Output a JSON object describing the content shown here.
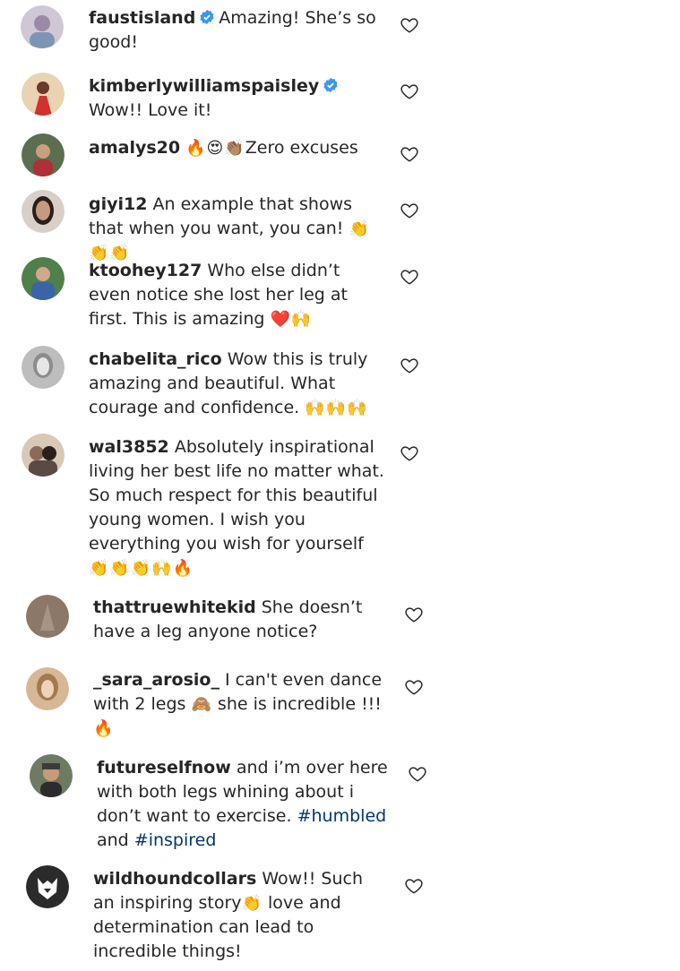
{
  "comments": [
    {
      "username": "faustisland",
      "verified": true,
      "text": "Amazing! She’s so good!",
      "avatar": "#b9a4b6"
    },
    {
      "username": "kimberlywilliamspaisley",
      "verified": true,
      "text": "Wow!! Love it!",
      "avatar": "#c98f6d"
    },
    {
      "username": "amalys20",
      "emoji": "🔥😍👏🏽",
      "text": "Zero excuses",
      "avatar": "#8a7a67"
    },
    {
      "username": "giyi12",
      "text": "An example that shows that when you want, you can!",
      "emoji": "👏👏👏",
      "avatar": "#4b3a31"
    },
    {
      "username": "ktoohey127",
      "text": "Who else didn’t even notice she lost her leg at first. This is amazing",
      "emoji": "❤️🙌",
      "avatar": "#5f7d90"
    },
    {
      "username": "chabelita_rico",
      "text": "Wow this is truly amazing and beautiful. What courage and confidence.",
      "emoji": "🙌🙌🙌",
      "avatar": "#a0a0a0"
    },
    {
      "username": "wal3852",
      "text": "Absolutely inspirational living her best life no matter what. So much respect for this beautiful young women. I wish you everything you wish for yourself",
      "emoji": "👏👏👏🙌🔥",
      "avatar": "#6a5a55"
    },
    {
      "username": "thattruewhitekid",
      "text": "She doesn’t have a leg anyone notice?",
      "avatar": "#8a7566"
    },
    {
      "username": "_sara_arosio_",
      "text_before": "I can't even dance with 2 legs",
      "emoji_mid": "🙈",
      "text": "she is incredible !!!",
      "emoji": "🔥",
      "avatar": "#c7a98a"
    },
    {
      "username": "futureselfnow",
      "text": "and i’m over here with both legs whining about i don’t want to exercise.",
      "tag1": "#humbled",
      "join": "and",
      "tag2": "#inspired",
      "avatar": "#7f8b6e"
    },
    {
      "username": "wildhoundcollars",
      "text_before": "Wow!! Such an inspiring story",
      "emoji_mid": "👏",
      "text": "love and determination can lead to incredible things!",
      "avatar": "#2b2b2b"
    }
  ]
}
